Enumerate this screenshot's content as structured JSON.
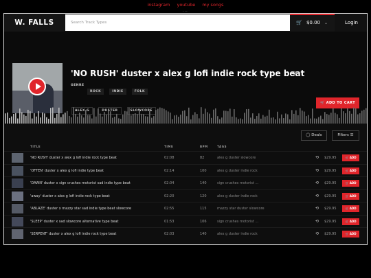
{
  "top_links": [
    "instagram",
    "youtube",
    "my songs"
  ],
  "top_dots": "...",
  "header": {
    "logo": "W. FALLS",
    "search_placeholder": "Search Track Types",
    "cart_total": "$0.00",
    "login": "Login"
  },
  "featured": {
    "title": "'NO RUSH' duster x alex g lofi indie rock type beat",
    "genre_label": "GENRE",
    "genres": [
      "ROCK",
      "INDIE",
      "FOLK"
    ],
    "tags": [
      "ALEX G",
      "DUSTER",
      "SLOWCORE"
    ],
    "add_to_cart": "ADD TO CART"
  },
  "controls": {
    "deals": "Deals",
    "filters": "Filters"
  },
  "columns": {
    "title": "TITLE",
    "time": "TIME",
    "bpm": "BPM",
    "tags": "TAGS"
  },
  "colors": {
    "accent": "#e0252b"
  },
  "tracks": [
    {
      "title": "'NO RUSH' duster x alex g lofi indie rock type beat",
      "time": "02:08",
      "bpm": "82",
      "tags": "alex g  duster  slowcore",
      "price": "$29.95",
      "add": "ADD"
    },
    {
      "title": "'OFTEN' duster x alex g lofi indie type beat",
      "time": "02:14",
      "bpm": "100",
      "tags": "alex g  duster  indie rock",
      "price": "$29.95",
      "add": "ADD"
    },
    {
      "title": "'DAWN' duster x sign crushes motorist sad indie type beat",
      "time": "02:04",
      "bpm": "140",
      "tags": "sign crushes motorist  ...",
      "price": "$29.95",
      "add": "ADD"
    },
    {
      "title": "'away' duster x alex g lofi indie rock type beat",
      "time": "02:20",
      "bpm": "120",
      "tags": "alex g  duster  indie rock",
      "price": "$29.95",
      "add": "ADD"
    },
    {
      "title": "'ABLAZE' duster x mazzy star sad indie type beat slowcore",
      "time": "02:55",
      "bpm": "115",
      "tags": "mazzy star  duster  slowcore",
      "price": "$29.95",
      "add": "ADD"
    },
    {
      "title": "'SLEEP' duster x sad slowcore alternative type beat",
      "time": "01:53",
      "bpm": "106",
      "tags": "sign crushes motorist  ...",
      "price": "$29.95",
      "add": "ADD"
    },
    {
      "title": "'SERPENT' duster x alex g lofi indie rock type beat",
      "time": "02:03",
      "bpm": "140",
      "tags": "alex g  duster  indie rock",
      "price": "$29.95",
      "add": "ADD"
    }
  ]
}
